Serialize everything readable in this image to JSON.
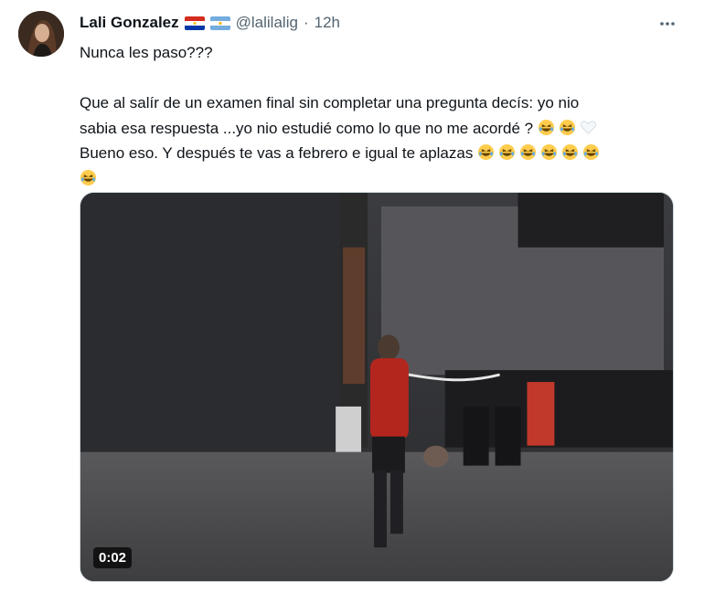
{
  "author": {
    "name": "Lali Gonzalez",
    "handle": "@lalilalig",
    "separator": "·",
    "time": "12h",
    "flags": [
      "paraguay-flag",
      "argentina-flag"
    ]
  },
  "tweet": {
    "line1": "Nunca les paso???",
    "line2a": "Que al salír de un examen final sin completar una pregunta decís: yo nio",
    "line2b": "sabia esa respuesta ...yo nio estudié como lo que no me acordé ? ",
    "line2c": "Bueno eso. Y después te vas a  febrero e igual te aplazas "
  },
  "video": {
    "duration": "0:02"
  },
  "colors": {
    "text": "#0f1419",
    "muted": "#536471",
    "border": "#cfd9de"
  },
  "icons": {
    "more": "more-options-icon",
    "laugh": "rolling-laughing-emoji",
    "heart": "white-heart-emoji"
  }
}
